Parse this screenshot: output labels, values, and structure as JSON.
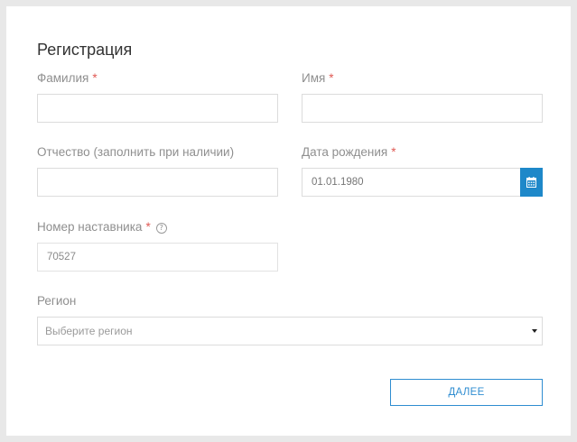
{
  "form": {
    "title": "Регистрация",
    "required_mark": "*",
    "last_name": {
      "label": "Фамилия",
      "value": ""
    },
    "first_name": {
      "label": "Имя",
      "value": ""
    },
    "middle_name": {
      "label": "Отчество (заполнить при наличии)",
      "value": ""
    },
    "birth_date": {
      "label": "Дата рождения",
      "placeholder": "01.01.1980",
      "icon": "calendar-icon"
    },
    "mentor_number": {
      "label": "Номер наставника",
      "value": "70527",
      "help_icon": "question-circle-icon"
    },
    "region": {
      "label": "Регион",
      "placeholder": "Выберите регион"
    },
    "next_button": "ДАЛЕЕ"
  },
  "colors": {
    "accent": "#1e88c9",
    "required": "#e05a55",
    "label": "#8f8f8f"
  }
}
